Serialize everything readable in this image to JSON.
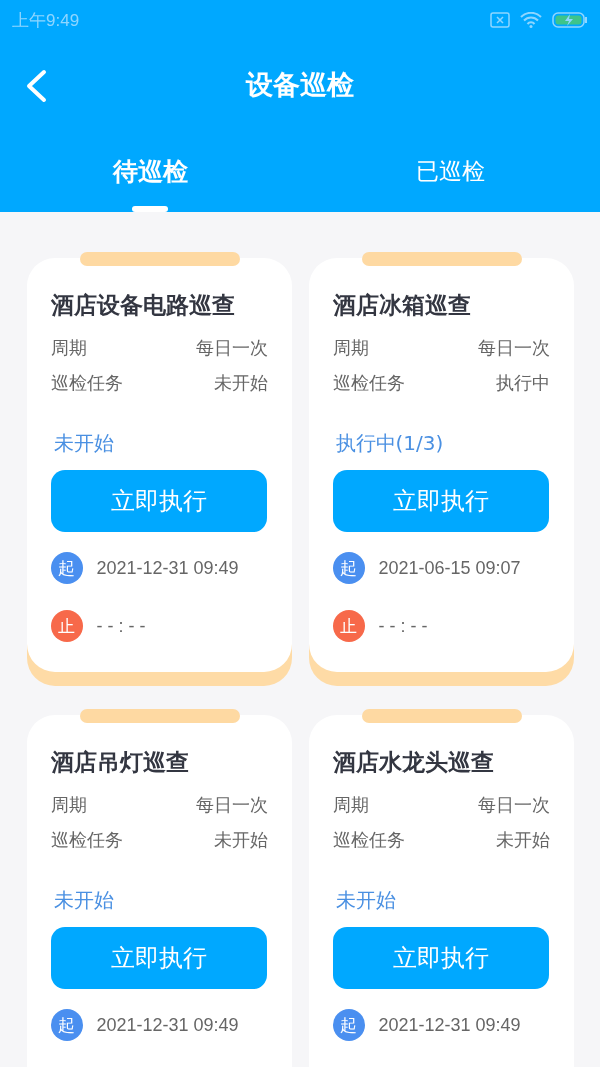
{
  "status_bar": {
    "time": "上午9:49"
  },
  "header": {
    "title": "设备巡检"
  },
  "tabs": [
    {
      "label": "待巡检",
      "selected": true
    },
    {
      "label": "已巡检",
      "selected": false
    }
  ],
  "cards": [
    {
      "title": "酒店设备电路巡查",
      "rows": [
        {
          "label": "周期",
          "value": "每日一次"
        },
        {
          "label": "巡检任务",
          "value": "未开始"
        }
      ],
      "status": "未开始",
      "button": "立即执行",
      "start": {
        "badge": "起",
        "time": "2021-12-31 09:49"
      },
      "end": {
        "badge": "止",
        "time": "- - : - -"
      }
    },
    {
      "title": "酒店冰箱巡查",
      "rows": [
        {
          "label": "周期",
          "value": "每日一次"
        },
        {
          "label": "巡检任务",
          "value": "执行中"
        }
      ],
      "status": "执行中(1/3)",
      "button": "立即执行",
      "start": {
        "badge": "起",
        "time": "2021-06-15 09:07"
      },
      "end": {
        "badge": "止",
        "time": "- - : - -"
      }
    },
    {
      "title": "酒店吊灯巡查",
      "rows": [
        {
          "label": "周期",
          "value": "每日一次"
        },
        {
          "label": "巡检任务",
          "value": "未开始"
        }
      ],
      "status": "未开始",
      "button": "立即执行",
      "start": {
        "badge": "起",
        "time": "2021-12-31 09:49"
      }
    },
    {
      "title": "酒店水龙头巡查",
      "rows": [
        {
          "label": "周期",
          "value": "每日一次"
        },
        {
          "label": "巡检任务",
          "value": "未开始"
        }
      ],
      "status": "未开始",
      "button": "立即执行",
      "start": {
        "badge": "起",
        "time": "2021-12-31 09:49"
      }
    }
  ]
}
